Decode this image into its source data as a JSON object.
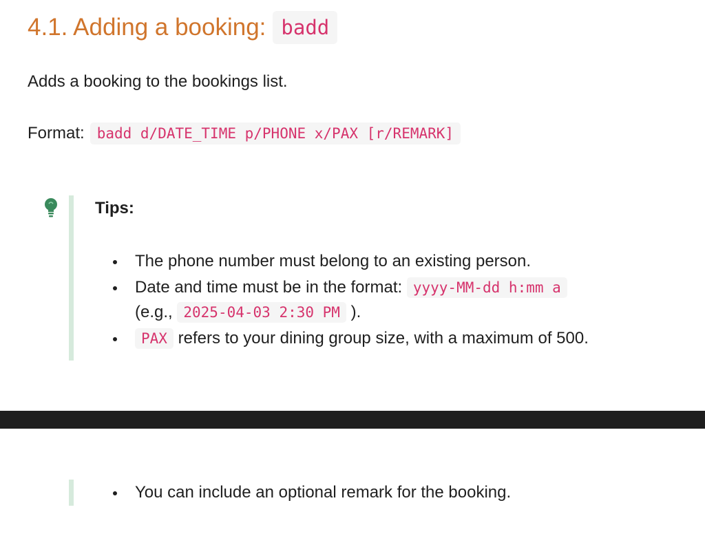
{
  "heading": {
    "prefix": "4.1. Adding a booking:",
    "command": "badd"
  },
  "description": "Adds a booking to the bookings list.",
  "format": {
    "label": "Format:",
    "syntax": "badd d/DATE_TIME p/PHONE x/PAX [r/REMARK]"
  },
  "tips": {
    "title": "Tips:",
    "icon": "lightbulb-icon",
    "icon_color": "#3a8a5c",
    "bar_color": "#d6eadc",
    "item1": "The phone number must belong to an existing person.",
    "item2": {
      "text_before": "Date and time must be in the format:",
      "format_code": "yyyy-MM-dd h:mm a",
      "eg_prefix": "(e.g.,",
      "example_code": "2025-04-03 2:30 PM",
      "eg_suffix": ")."
    },
    "item3": {
      "code": "PAX",
      "text": "refers to your dining group size, with a maximum of 500."
    },
    "item4": "You can include an optional remark for the booking."
  },
  "colors": {
    "heading": "#d0752c",
    "code_text": "#d6336c",
    "code_bg": "#f5f5f5",
    "divider": "#1e1e1e"
  }
}
